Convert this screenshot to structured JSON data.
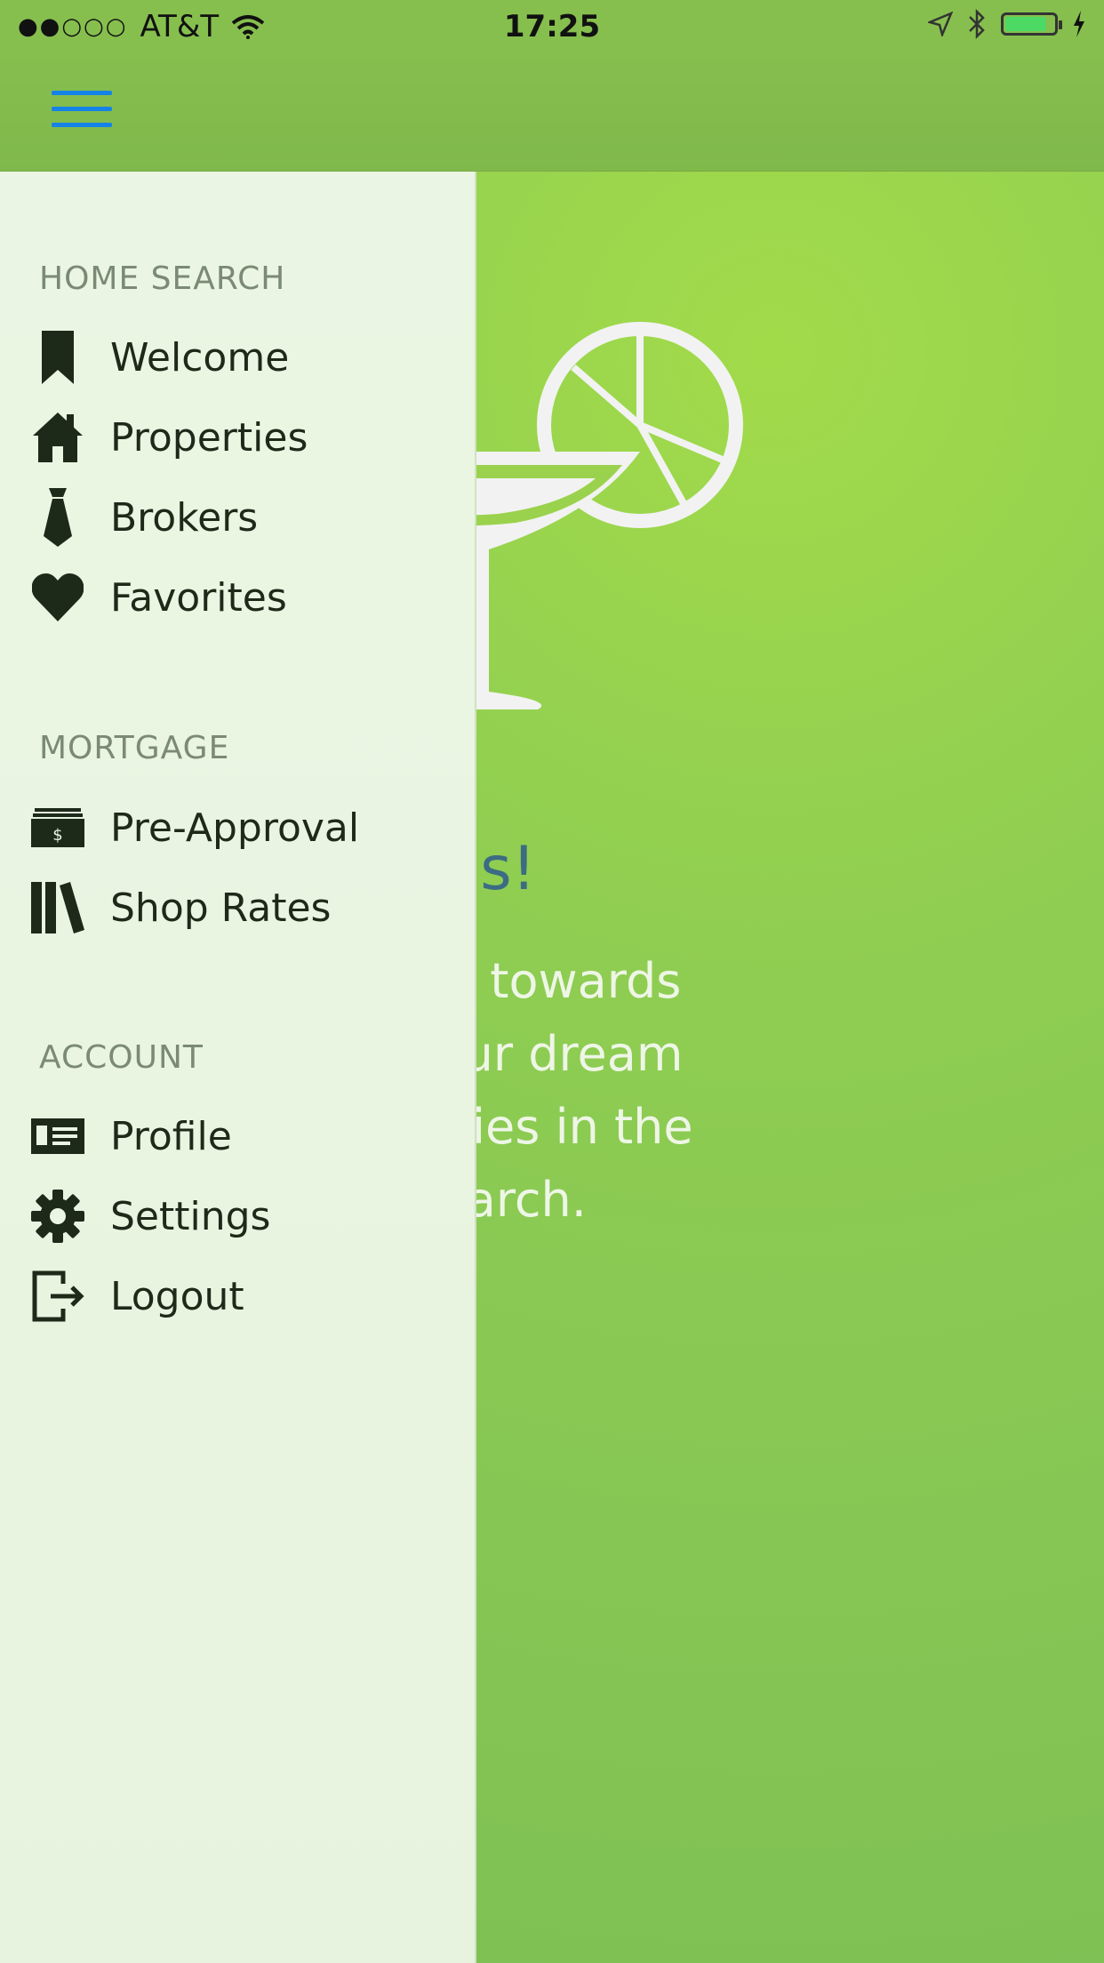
{
  "status_bar": {
    "signal": "●●○○○",
    "carrier": "AT&T",
    "time": "17:25"
  },
  "nav": {
    "menu_icon": "hamburger-icon",
    "accent": "#1583e6"
  },
  "drawer": {
    "sections": [
      {
        "title": "HOME SEARCH",
        "items": [
          {
            "label": "Welcome",
            "icon": "bookmark-icon"
          },
          {
            "label": "Properties",
            "icon": "house-icon"
          },
          {
            "label": "Brokers",
            "icon": "tie-icon"
          },
          {
            "label": "Favorites",
            "icon": "heart-icon"
          }
        ]
      },
      {
        "title": "MORTGAGE",
        "items": [
          {
            "label": "Pre-Approval",
            "icon": "money-icon"
          },
          {
            "label": "Shop Rates",
            "icon": "books-icon"
          }
        ]
      },
      {
        "title": "ACCOUNT",
        "items": [
          {
            "label": "Profile",
            "icon": "id-card-icon"
          },
          {
            "label": "Settings",
            "icon": "gear-icon"
          },
          {
            "label": "Logout",
            "icon": "logout-icon"
          }
        ]
      }
    ]
  },
  "main": {
    "title": "ratulations!",
    "body_lines": [
      "he first step towards",
      "hip. Find your dream",
      "ting properties in the",
      "tart your search."
    ],
    "title_color": "#3c6c83"
  }
}
